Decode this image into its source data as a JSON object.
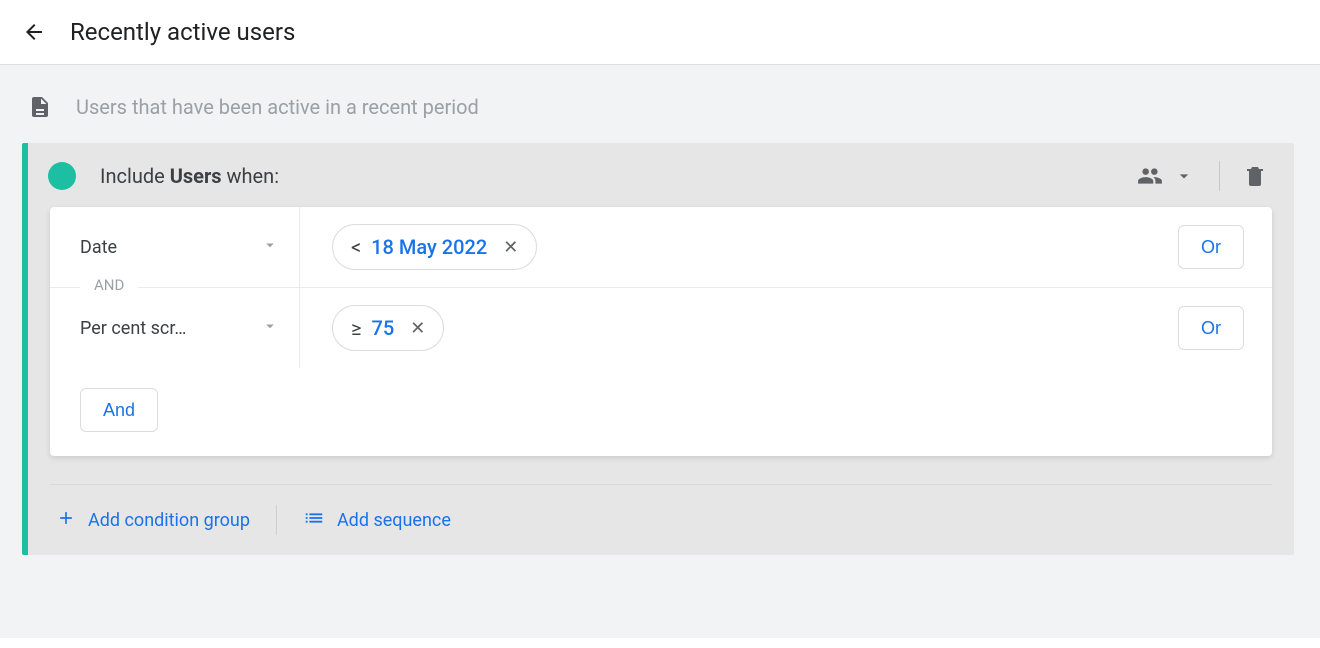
{
  "header": {
    "title": "Recently active users"
  },
  "description": "Users that have been active in a recent period",
  "group": {
    "include_prefix": "Include ",
    "scope_word": "Users",
    "include_suffix": " when:"
  },
  "conditions": [
    {
      "dimension": "Date",
      "operator": "<",
      "value": "18 May 2022",
      "join_before": null
    },
    {
      "dimension": "Per cent scr…",
      "operator": "≥",
      "value": "75",
      "join_before": "AND"
    }
  ],
  "buttons": {
    "or": "Or",
    "and": "And",
    "add_group": "Add condition group",
    "add_sequence": "Add sequence"
  }
}
